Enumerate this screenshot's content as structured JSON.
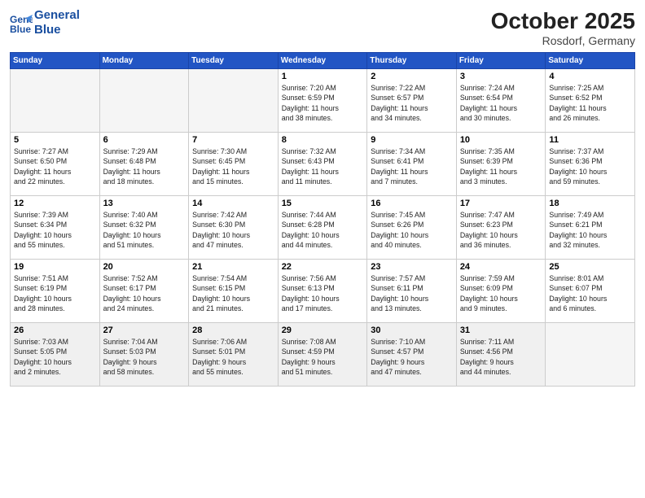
{
  "header": {
    "logo_line1": "General",
    "logo_line2": "Blue",
    "month": "October 2025",
    "location": "Rosdorf, Germany"
  },
  "weekdays": [
    "Sunday",
    "Monday",
    "Tuesday",
    "Wednesday",
    "Thursday",
    "Friday",
    "Saturday"
  ],
  "weeks": [
    [
      {
        "day": "",
        "info": ""
      },
      {
        "day": "",
        "info": ""
      },
      {
        "day": "",
        "info": ""
      },
      {
        "day": "1",
        "info": "Sunrise: 7:20 AM\nSunset: 6:59 PM\nDaylight: 11 hours\nand 38 minutes."
      },
      {
        "day": "2",
        "info": "Sunrise: 7:22 AM\nSunset: 6:57 PM\nDaylight: 11 hours\nand 34 minutes."
      },
      {
        "day": "3",
        "info": "Sunrise: 7:24 AM\nSunset: 6:54 PM\nDaylight: 11 hours\nand 30 minutes."
      },
      {
        "day": "4",
        "info": "Sunrise: 7:25 AM\nSunset: 6:52 PM\nDaylight: 11 hours\nand 26 minutes."
      }
    ],
    [
      {
        "day": "5",
        "info": "Sunrise: 7:27 AM\nSunset: 6:50 PM\nDaylight: 11 hours\nand 22 minutes."
      },
      {
        "day": "6",
        "info": "Sunrise: 7:29 AM\nSunset: 6:48 PM\nDaylight: 11 hours\nand 18 minutes."
      },
      {
        "day": "7",
        "info": "Sunrise: 7:30 AM\nSunset: 6:45 PM\nDaylight: 11 hours\nand 15 minutes."
      },
      {
        "day": "8",
        "info": "Sunrise: 7:32 AM\nSunset: 6:43 PM\nDaylight: 11 hours\nand 11 minutes."
      },
      {
        "day": "9",
        "info": "Sunrise: 7:34 AM\nSunset: 6:41 PM\nDaylight: 11 hours\nand 7 minutes."
      },
      {
        "day": "10",
        "info": "Sunrise: 7:35 AM\nSunset: 6:39 PM\nDaylight: 11 hours\nand 3 minutes."
      },
      {
        "day": "11",
        "info": "Sunrise: 7:37 AM\nSunset: 6:36 PM\nDaylight: 10 hours\nand 59 minutes."
      }
    ],
    [
      {
        "day": "12",
        "info": "Sunrise: 7:39 AM\nSunset: 6:34 PM\nDaylight: 10 hours\nand 55 minutes."
      },
      {
        "day": "13",
        "info": "Sunrise: 7:40 AM\nSunset: 6:32 PM\nDaylight: 10 hours\nand 51 minutes."
      },
      {
        "day": "14",
        "info": "Sunrise: 7:42 AM\nSunset: 6:30 PM\nDaylight: 10 hours\nand 47 minutes."
      },
      {
        "day": "15",
        "info": "Sunrise: 7:44 AM\nSunset: 6:28 PM\nDaylight: 10 hours\nand 44 minutes."
      },
      {
        "day": "16",
        "info": "Sunrise: 7:45 AM\nSunset: 6:26 PM\nDaylight: 10 hours\nand 40 minutes."
      },
      {
        "day": "17",
        "info": "Sunrise: 7:47 AM\nSunset: 6:23 PM\nDaylight: 10 hours\nand 36 minutes."
      },
      {
        "day": "18",
        "info": "Sunrise: 7:49 AM\nSunset: 6:21 PM\nDaylight: 10 hours\nand 32 minutes."
      }
    ],
    [
      {
        "day": "19",
        "info": "Sunrise: 7:51 AM\nSunset: 6:19 PM\nDaylight: 10 hours\nand 28 minutes."
      },
      {
        "day": "20",
        "info": "Sunrise: 7:52 AM\nSunset: 6:17 PM\nDaylight: 10 hours\nand 24 minutes."
      },
      {
        "day": "21",
        "info": "Sunrise: 7:54 AM\nSunset: 6:15 PM\nDaylight: 10 hours\nand 21 minutes."
      },
      {
        "day": "22",
        "info": "Sunrise: 7:56 AM\nSunset: 6:13 PM\nDaylight: 10 hours\nand 17 minutes."
      },
      {
        "day": "23",
        "info": "Sunrise: 7:57 AM\nSunset: 6:11 PM\nDaylight: 10 hours\nand 13 minutes."
      },
      {
        "day": "24",
        "info": "Sunrise: 7:59 AM\nSunset: 6:09 PM\nDaylight: 10 hours\nand 9 minutes."
      },
      {
        "day": "25",
        "info": "Sunrise: 8:01 AM\nSunset: 6:07 PM\nDaylight: 10 hours\nand 6 minutes."
      }
    ],
    [
      {
        "day": "26",
        "info": "Sunrise: 7:03 AM\nSunset: 5:05 PM\nDaylight: 10 hours\nand 2 minutes."
      },
      {
        "day": "27",
        "info": "Sunrise: 7:04 AM\nSunset: 5:03 PM\nDaylight: 9 hours\nand 58 minutes."
      },
      {
        "day": "28",
        "info": "Sunrise: 7:06 AM\nSunset: 5:01 PM\nDaylight: 9 hours\nand 55 minutes."
      },
      {
        "day": "29",
        "info": "Sunrise: 7:08 AM\nSunset: 4:59 PM\nDaylight: 9 hours\nand 51 minutes."
      },
      {
        "day": "30",
        "info": "Sunrise: 7:10 AM\nSunset: 4:57 PM\nDaylight: 9 hours\nand 47 minutes."
      },
      {
        "day": "31",
        "info": "Sunrise: 7:11 AM\nSunset: 4:56 PM\nDaylight: 9 hours\nand 44 minutes."
      },
      {
        "day": "",
        "info": ""
      }
    ]
  ]
}
